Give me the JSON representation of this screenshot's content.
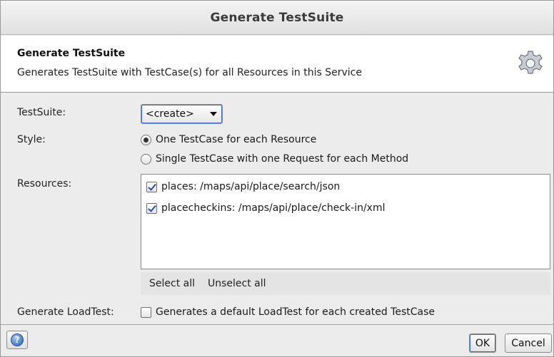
{
  "window": {
    "title": "Generate TestSuite"
  },
  "header": {
    "title": "Generate TestSuite",
    "description": "Generates TestSuite with TestCase(s) for all Resources in this Service",
    "icon": "gear-icon"
  },
  "form": {
    "testsuite_label": "TestSuite:",
    "testsuite_value": "<create>",
    "style_label": "Style:",
    "style_options": [
      {
        "label": "One TestCase for each Resource",
        "checked": true
      },
      {
        "label": "Single TestCase with one Request for each Method",
        "checked": false
      }
    ],
    "resources_label": "Resources:",
    "resources": [
      {
        "label": "places: /maps/api/place/search/json",
        "checked": true
      },
      {
        "label": "placecheckins: /maps/api/place/check-in/xml",
        "checked": true
      }
    ],
    "select_all": "Select all",
    "unselect_all": "Unselect all",
    "loadtest_label": "Generate LoadTest:",
    "loadtest_option": {
      "label": "Generates a default LoadTest for each created TestCase",
      "checked": false
    }
  },
  "footer": {
    "help_icon": "help-icon",
    "help_glyph": "?",
    "ok_label": "OK",
    "cancel_label": "Cancel"
  }
}
